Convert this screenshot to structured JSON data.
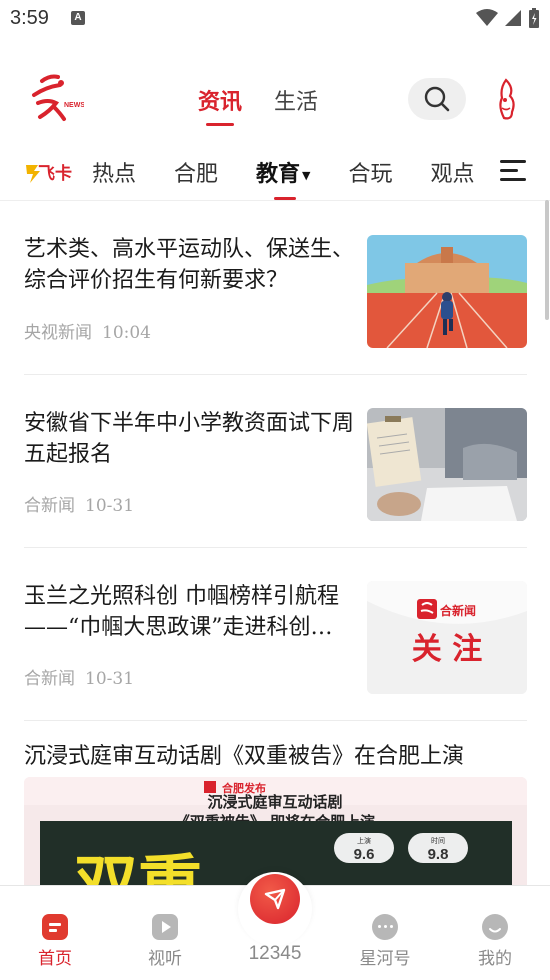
{
  "status_bar": {
    "time": "3:59",
    "notification_badge": "A"
  },
  "header": {
    "tabs": [
      {
        "label": "资讯",
        "active": true
      },
      {
        "label": "生活",
        "active": false
      }
    ],
    "logo_icon": "hefei-news-logo",
    "search_icon": "search-icon",
    "mascot_icon": "mascot-icon"
  },
  "channels": {
    "feika_label": "飞卡",
    "items": [
      {
        "label": "热点",
        "active": false
      },
      {
        "label": "合肥",
        "active": false
      },
      {
        "label": "教育",
        "active": true
      },
      {
        "label": "合玩",
        "active": false
      },
      {
        "label": "观点",
        "active": false
      }
    ]
  },
  "articles": [
    {
      "title": "艺术类、高水平运动队、保送生、综合评价招生有何新要求？",
      "source": "央视新闻",
      "time": "10:04"
    },
    {
      "title": "安徽省下半年中小学教资面试下周五起报名",
      "source": "合新闻",
      "time": "10-31"
    },
    {
      "title": "玉兰之光照科创 巾帼榜样引航程——“巾帼大思政课”走进科创一线",
      "source": "合新闻",
      "time": "10-31",
      "thumb_brand": "合新闻",
      "thumb_text": "关 注"
    },
    {
      "title": "沉浸式庭审互动话剧《双重被告》在合肥上演"
    }
  ],
  "poster": {
    "brand": "合肥发布",
    "line1": "沉浸式庭审互动话剧",
    "line2": "《双重被告》 即将在合肥上演",
    "date1_label": "上演",
    "date1": "9.6",
    "date2_label": "时间",
    "date2": "9.8",
    "big_text": "双重"
  },
  "bottom_nav": [
    {
      "label": "首页",
      "icon": "home-icon",
      "active": true
    },
    {
      "label": "视听",
      "icon": "play-icon",
      "active": false
    },
    {
      "label": "12345",
      "icon": "hotline-icon",
      "active": false
    },
    {
      "label": "星河号",
      "icon": "chat-icon",
      "active": false
    },
    {
      "label": "我的",
      "icon": "profile-icon",
      "active": false
    }
  ],
  "colors": {
    "accent": "#d9232d",
    "muted": "#a6a6a6"
  }
}
